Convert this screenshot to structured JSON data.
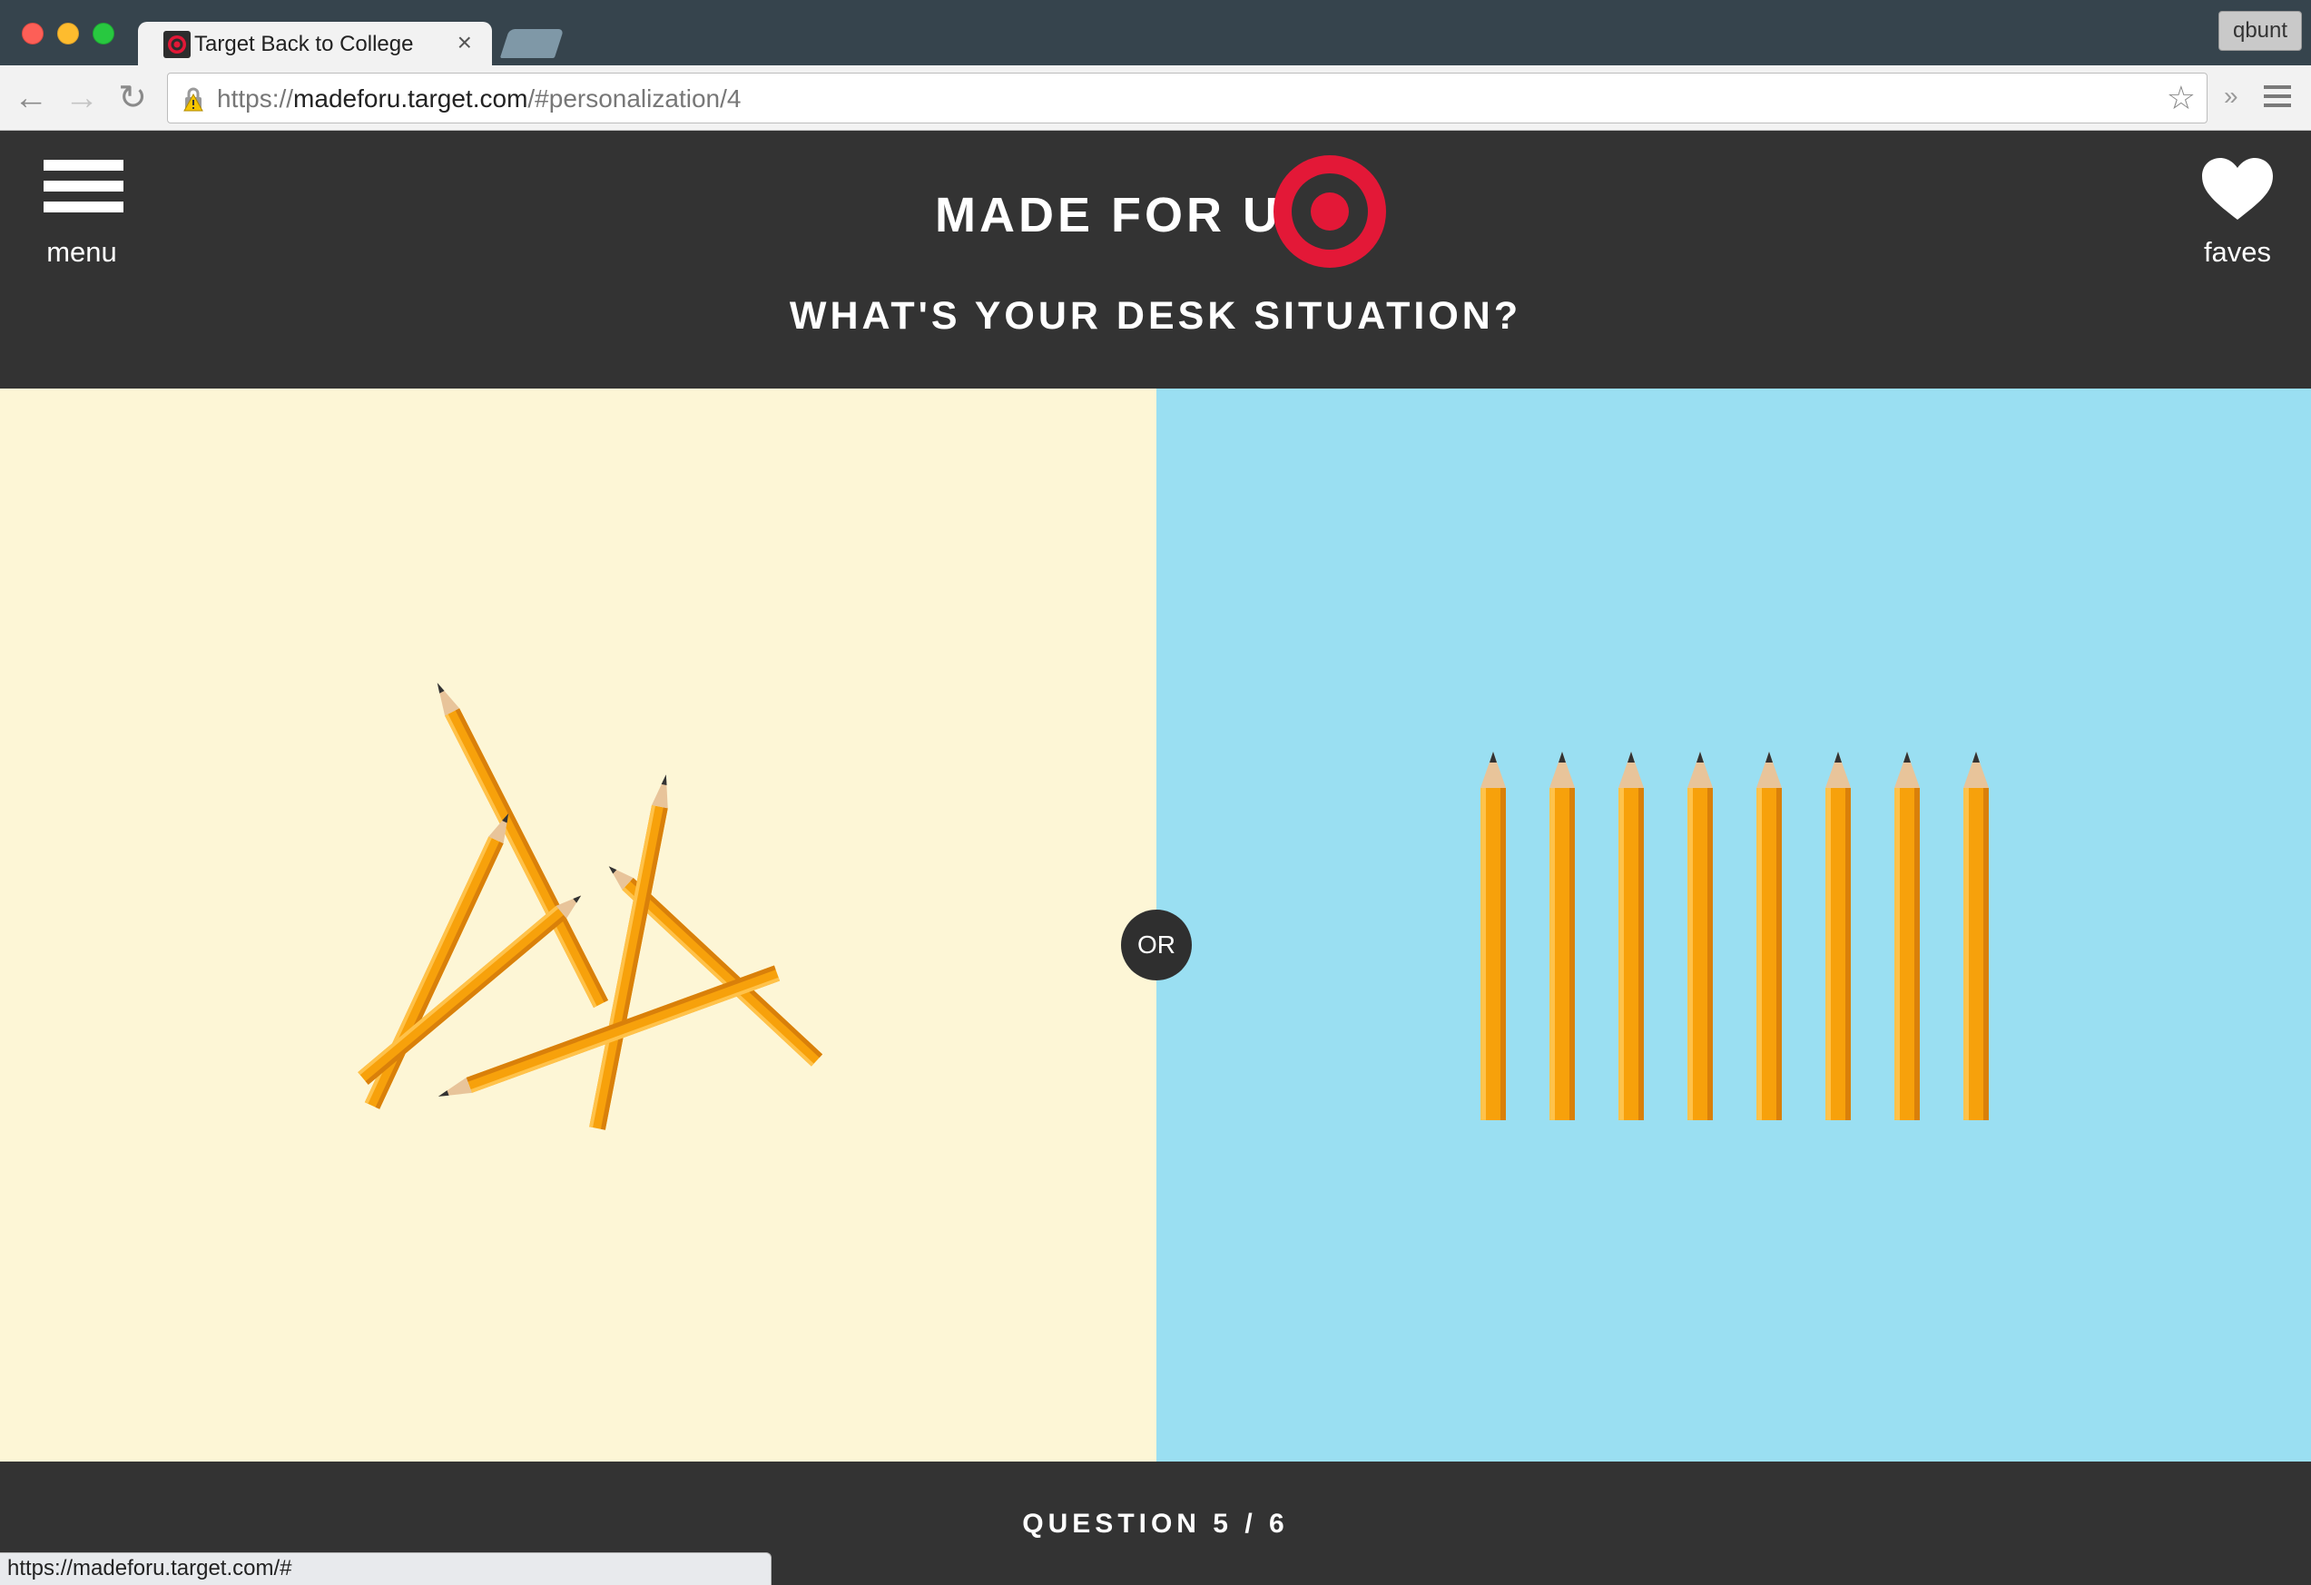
{
  "browser": {
    "tab_title": "Target Back to College",
    "tab_close": "×",
    "profile": "qbunt",
    "url_scheme": "https://",
    "url_host": "madeforu.target.com",
    "url_path": "/#personalization/4",
    "more": "»",
    "status_url": "https://madeforu.target.com/#"
  },
  "header": {
    "menu_label": "menu",
    "logo_text": "MADE FOR U",
    "faves_label": "faves",
    "question": "WHAT'S YOUR DESK SITUATION?"
  },
  "choices": {
    "or_label": "OR",
    "left_image": "messy-pencils",
    "right_image": "neat-pencils"
  },
  "footer": {
    "progress": "QUESTION 5 / 6"
  },
  "colors": {
    "header_bg": "#333333",
    "left_bg": "#fdf6d6",
    "right_bg": "#9adff2",
    "brand_red": "#e31837",
    "pencil": "#f7a10b"
  }
}
